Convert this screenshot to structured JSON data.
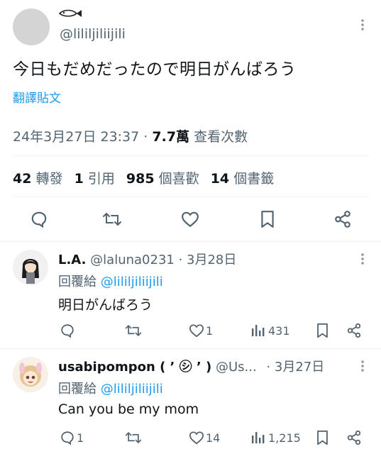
{
  "main_tweet": {
    "username_top_glyph": "",
    "handle": "@lililjiliijili",
    "text": "今日もだめだったので明日がんばろう",
    "translate_label": "翻譯貼文",
    "timestamp": "24年3月27日 23:37",
    "separator": "·",
    "views_count": "7.7萬",
    "views_label": "查看次數",
    "stats": [
      {
        "count": "42",
        "label": "轉發"
      },
      {
        "count": "1",
        "label": "引用"
      },
      {
        "count": "985",
        "label": "個喜歡"
      },
      {
        "count": "14",
        "label": "個書籤"
      }
    ]
  },
  "replies": [
    {
      "name": "L.A.",
      "handle": "@laluna0231",
      "date": "· 3月28日",
      "reply_prefix": "回覆給",
      "reply_to": "@lililjiliijili",
      "text": "明日がんばろう",
      "likes": "1",
      "views": "431",
      "replies_count": ""
    },
    {
      "name": "usabipompon ( ’ ㋛ ’ )",
      "handle": "@Us...",
      "date": "· 3月27日",
      "reply_prefix": "回覆給",
      "reply_to": "@lililjiliijili",
      "text": "Can you be my mom",
      "replies_count": "1",
      "likes": "14",
      "views": "1,215"
    }
  ],
  "colors": {
    "accent": "#1d9bf0",
    "muted": "#536471",
    "divider": "#eff3f4"
  }
}
